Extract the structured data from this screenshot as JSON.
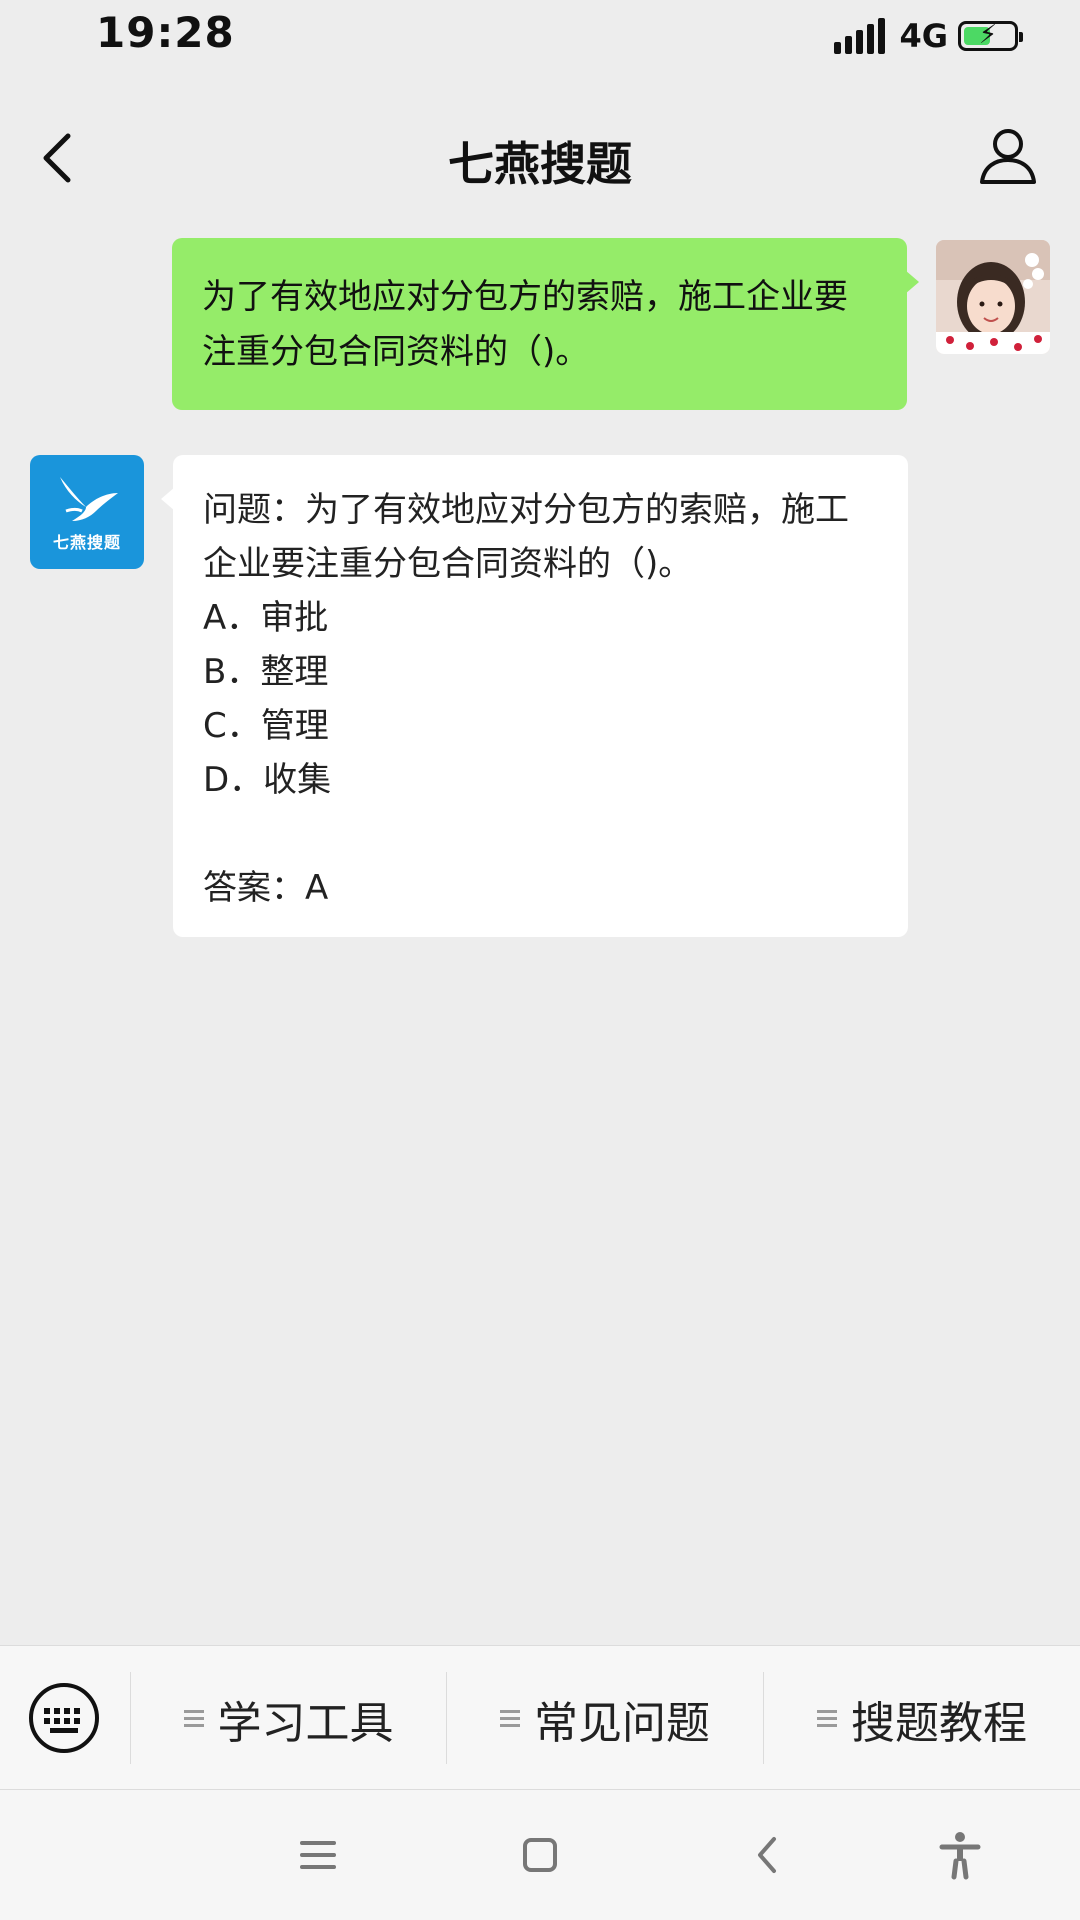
{
  "status_bar": {
    "time": "19:28",
    "network": "4G",
    "battery_level": 0.55,
    "charging": true
  },
  "nav": {
    "title": "七燕搜题",
    "back_icon": "chevron-left-icon",
    "profile_icon": "user-icon"
  },
  "messages": {
    "user": {
      "text": "为了有效地应对分包方的索赔，施工企业要注重分包合同资料的（)。"
    },
    "bot": {
      "avatar_label": "七燕搜题",
      "question": "问题：为了有效地应对分包方的索赔，施工企业要注重分包合同资料的（)。",
      "options": [
        "A．审批",
        "B．整理",
        "C．管理",
        "D．收集"
      ],
      "answer": "答案：A"
    }
  },
  "bottom_menu": {
    "keyboard_icon": "keyboard-icon",
    "items": [
      {
        "label": "学习工具"
      },
      {
        "label": "常见问题"
      },
      {
        "label": "搜题教程"
      }
    ]
  },
  "system_nav": {
    "icons": [
      "menu-icon",
      "home-icon",
      "back-icon",
      "accessibility-icon"
    ]
  },
  "colors": {
    "background": "#ededed",
    "user_bubble": "#95ec69",
    "bot_bubble": "#ffffff",
    "bot_avatar": "#1a95db"
  }
}
